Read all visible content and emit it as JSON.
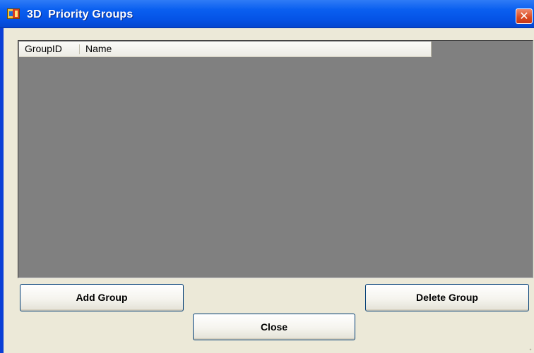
{
  "window": {
    "title": "3D  Priority Groups",
    "close_symbol": "✕"
  },
  "list": {
    "columns": [
      "GroupID",
      "Name"
    ],
    "rows": []
  },
  "buttons": {
    "add_group": "Add Group",
    "delete_group": "Delete Group",
    "close": "Close"
  },
  "icons": {
    "app": "app-window-icon",
    "close": "close-icon",
    "resize": "resize-grip-icon"
  },
  "colors": {
    "titlebar": "#0553e6",
    "window_background": "#ece9d8",
    "list_background": "#808080",
    "close_button": "#d9491f",
    "button_border": "#003c74"
  }
}
